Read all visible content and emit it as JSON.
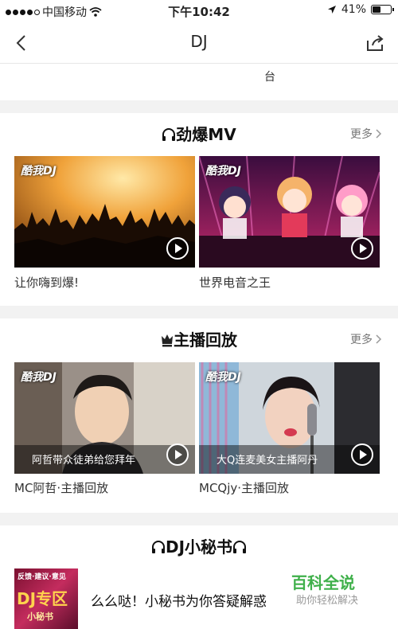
{
  "status_bar": {
    "carrier": "中国移动",
    "time": "下午10:42",
    "battery_text": "41%",
    "battery_level": 0.41
  },
  "nav": {
    "title": "DJ"
  },
  "top_fragment": "台",
  "sections": {
    "mv": {
      "title": "劲爆MV",
      "more": "更多",
      "items": [
        {
          "caption": "让你嗨到爆!"
        },
        {
          "caption": "世界电音之王"
        }
      ]
    },
    "replay": {
      "title": "主播回放",
      "more": "更多",
      "items": [
        {
          "overlay": "阿哲带众徒弟给您拜年",
          "caption": "MC阿哲·主播回放"
        },
        {
          "overlay": "大Q连麦美女主播阿丹",
          "caption": "MCQjy·主播回放"
        }
      ]
    },
    "secretary": {
      "title": "DJ小秘书",
      "thumb_line1": "反馈·建议·意见",
      "thumb_line2": "DJ专区",
      "thumb_line3": "小秘书",
      "text": "么么哒！小秘书为你答疑解惑"
    }
  },
  "logo_text": "酷我DJ",
  "watermark": {
    "main": "百科全说",
    "sub": "助你轻松解决"
  }
}
